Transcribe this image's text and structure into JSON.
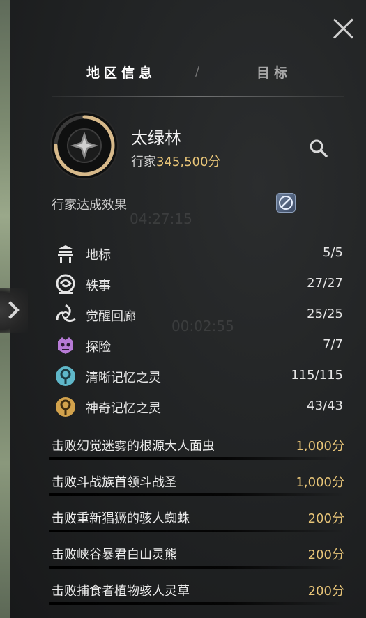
{
  "tabs": [
    {
      "label": "地区信息",
      "active": true
    },
    {
      "label": "目标",
      "active": false
    }
  ],
  "tab_separator": "/",
  "region": {
    "name": "太绿林",
    "score_label": "行家",
    "score_value": "345,500分",
    "progress": 0.75
  },
  "bonus": {
    "label": "行家达成效果"
  },
  "categories": [
    {
      "icon": "landmark-icon",
      "label": "地标",
      "count": "5/5"
    },
    {
      "icon": "anecdote-icon",
      "label": "轶事",
      "count": "27/27"
    },
    {
      "icon": "awakening-corridor-icon",
      "label": "觉醒回廊",
      "count": "25/25"
    },
    {
      "icon": "adventure-icon",
      "label": "探险",
      "count": "7/7"
    },
    {
      "icon": "clear-memory-spirit-icon",
      "label": "清晰记忆之灵",
      "count": "115/115"
    },
    {
      "icon": "mysterious-memory-spirit-icon",
      "label": "神奇记忆之灵",
      "count": "43/43"
    }
  ],
  "tasks": [
    {
      "label": "击败幻觉迷雾的根源大人面虫",
      "value": "1,000分"
    },
    {
      "label": "击败斗战族首领斗战圣",
      "value": "1,000分"
    },
    {
      "label": "击败重新猖獗的骇人蜘蛛",
      "value": "200分"
    },
    {
      "label": "击败峡谷暴君白山灵熊",
      "value": "200分"
    },
    {
      "label": "击败捕食者植物骇人灵草",
      "value": "200分"
    }
  ],
  "background": {
    "timer1": "04:27:15",
    "timer2": "00:02:55"
  },
  "colors": {
    "accent_gold": "#e8c578",
    "panel_bg": "#202223",
    "clear_spirit": "#5fb7c9",
    "mysterious_spirit": "#d2a24c",
    "adventure": "#b77bd6"
  }
}
